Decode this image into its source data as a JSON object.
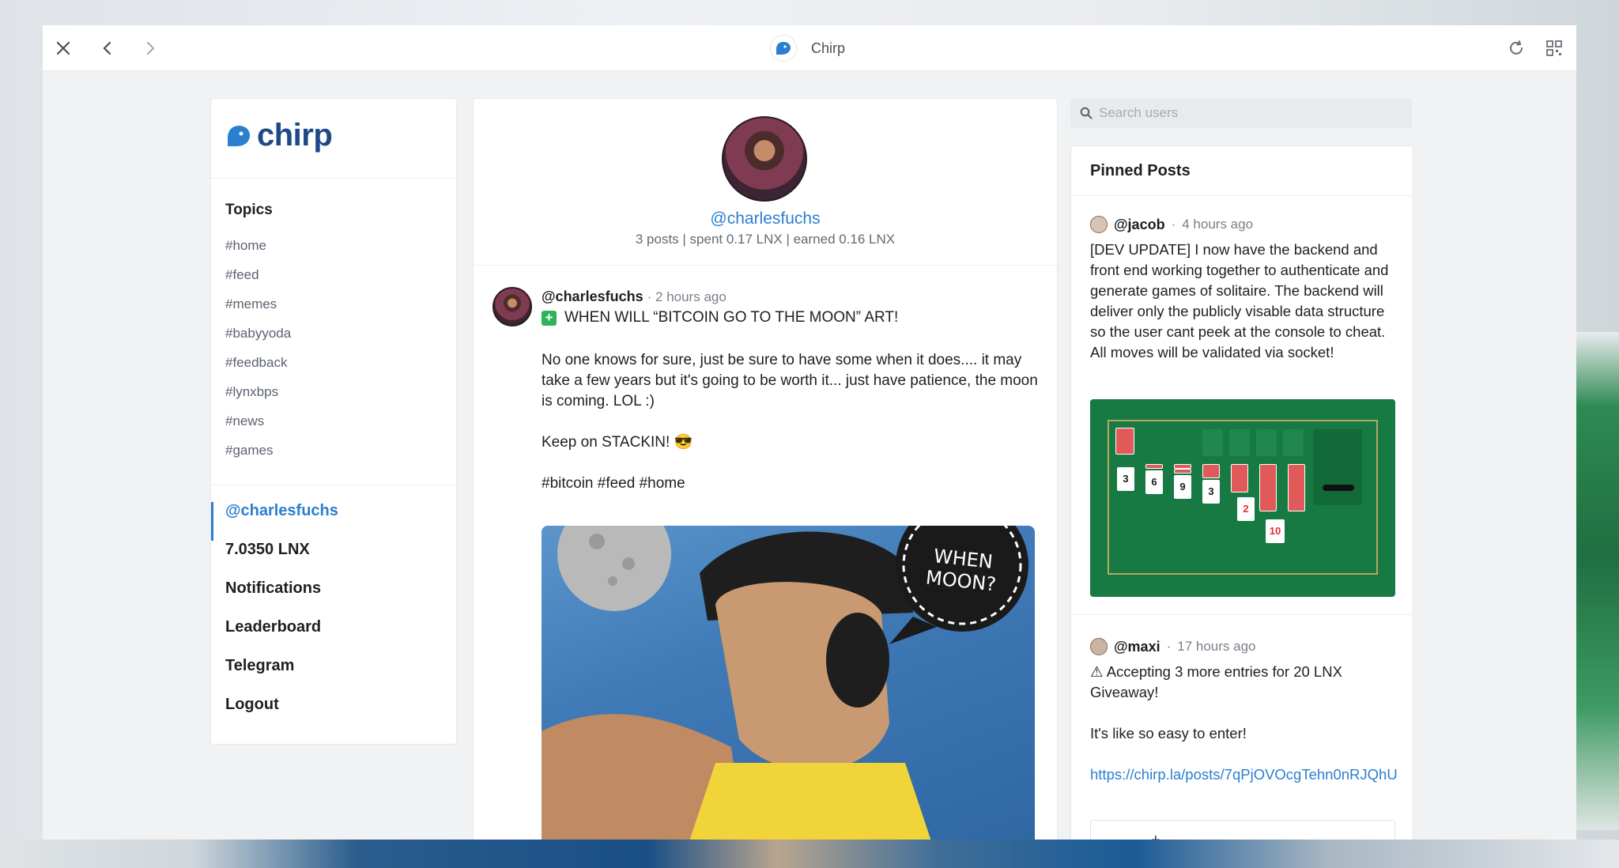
{
  "window": {
    "title": "Chirp"
  },
  "brand": {
    "name": "chirp",
    "color": "#1d4a86",
    "accent": "#2b7fcf"
  },
  "sidebar": {
    "topics_title": "Topics",
    "topics": [
      "#home",
      "#feed",
      "#memes",
      "#babyyoda",
      "#feedback",
      "#lynxbps",
      "#news",
      "#games"
    ],
    "menu": [
      {
        "label": "@charlesfuchs",
        "active": true
      },
      {
        "label": "7.0350 LNX"
      },
      {
        "label": "Notifications"
      },
      {
        "label": "Leaderboard"
      },
      {
        "label": "Telegram"
      },
      {
        "label": "Logout"
      }
    ]
  },
  "profile": {
    "handle": "@charlesfuchs",
    "stats": "3 posts | spent 0.17 LNX | earned 0.16 LNX"
  },
  "post": {
    "author": "@charlesfuchs",
    "time": "2 hours ago",
    "title": "WHEN WILL “BITCOIN GO TO THE MOON” ART!",
    "body": [
      "No one knows for sure, just be sure to have some when it does.... it may take a few years but it's going to be worth it... just have patience, the moon is coming. LOL :)",
      "Keep on STACKIN! 😎",
      "#bitcoin #feed #home"
    ],
    "image_caption": "WHEN MOON?"
  },
  "search": {
    "placeholder": "Search users"
  },
  "pinned": {
    "title": "Pinned Posts",
    "posts": [
      {
        "author": "@jacob",
        "time": "4 hours ago",
        "text": "[DEV UPDATE] I now have the backend and front end working together to authenticate and generate games of solitaire. The backend will deliver only the publicly visable data structure so the user cant peek at the console to cheat. All moves will be validated via socket!"
      },
      {
        "author": "@maxi",
        "time": "17 hours ago",
        "text_lines": [
          "⚠ Accepting 3 more entries for 20 LNX Giveaway!",
          "It's like so easy to enter!"
        ],
        "link": "https://chirp.la/posts/7qPjOVOcgTehn0nRJQhU"
      }
    ],
    "solitaire_cards": [
      "3",
      "6",
      "9",
      "3",
      "2",
      "10"
    ]
  },
  "add_label": "+"
}
